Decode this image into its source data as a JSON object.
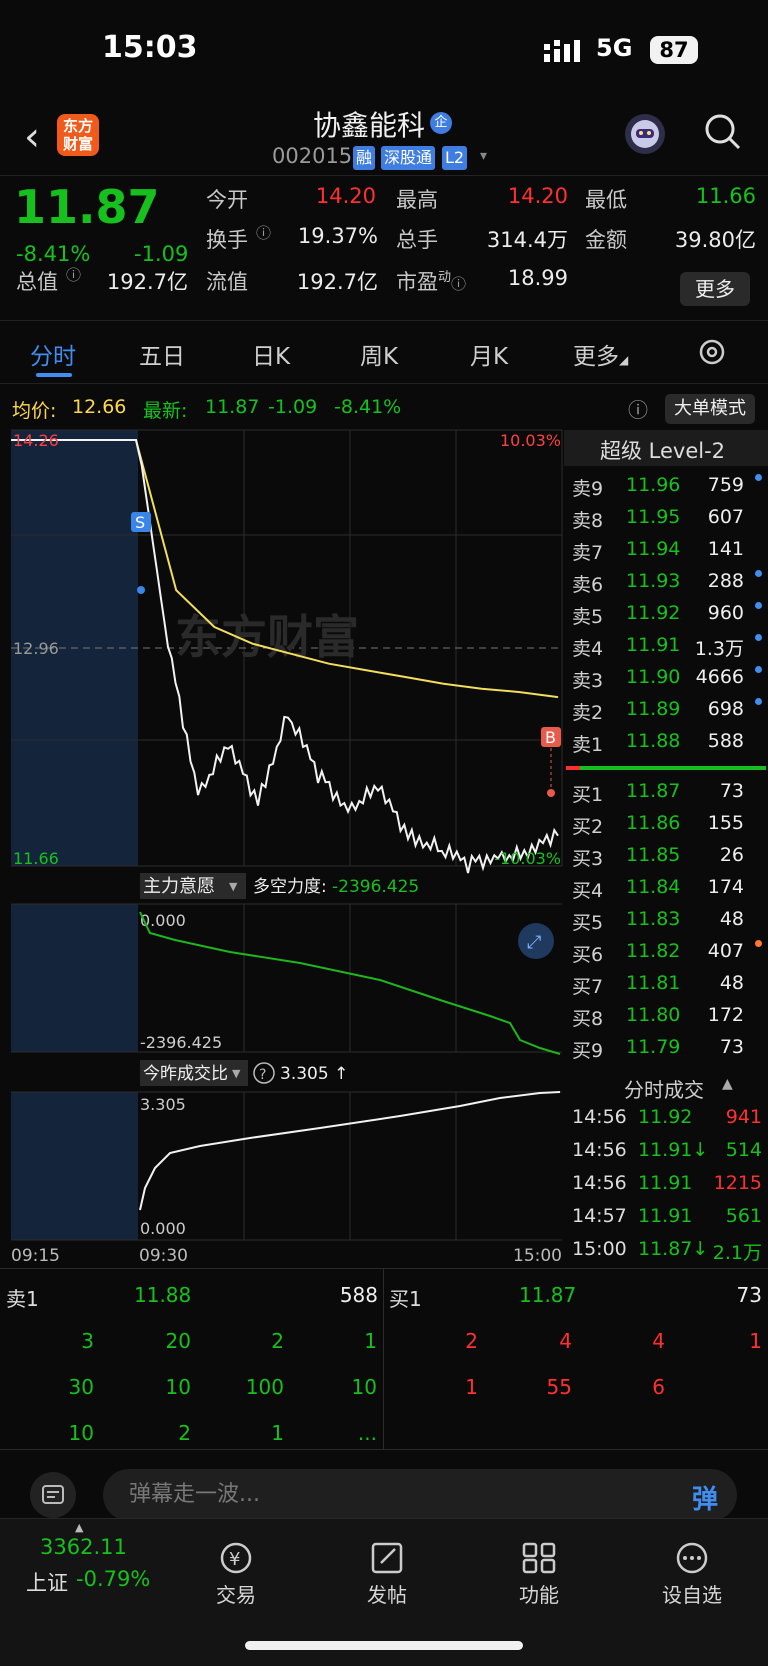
{
  "status_bar": {
    "time": "15:03",
    "network": "5G",
    "battery": "87"
  },
  "header": {
    "logo_line1": "东方",
    "logo_line2": "财富",
    "stock_name": "协鑫能科",
    "enterprise_badge": "企",
    "stock_code": "002015",
    "tags": [
      "融",
      "深股通",
      "L2"
    ]
  },
  "quote": {
    "price": "11.87",
    "change_pct": "-8.41%",
    "change": "-1.09",
    "stats": [
      {
        "label": "今开",
        "value": "14.20",
        "color": "#ff3030"
      },
      {
        "label": "最高",
        "value": "14.20",
        "color": "#ff3030"
      },
      {
        "label": "最低",
        "value": "11.66",
        "color": "#17c11d"
      },
      {
        "label": "换手",
        "value": "19.37%",
        "color": "#ececec"
      },
      {
        "label": "总手",
        "value": "314.4万",
        "color": "#ececec"
      },
      {
        "label": "金额",
        "value": "39.80亿",
        "color": "#ececec"
      },
      {
        "label": "总值",
        "value": "192.7亿",
        "color": "#ececec"
      },
      {
        "label": "流值",
        "value": "192.7亿",
        "color": "#ececec"
      },
      {
        "label": "市盈",
        "label_sup": "动",
        "value": "18.99",
        "color": "#ececec"
      }
    ],
    "more_label": "更多"
  },
  "tabs": [
    "分时",
    "五日",
    "日K",
    "周K",
    "月K",
    "更多"
  ],
  "chart_info": {
    "avg_label": "均价:",
    "avg_value": "12.66",
    "latest_label": "最新:",
    "latest_value": "11.87",
    "latest_change": "-1.09",
    "latest_pct": "-8.41%",
    "big_order_mode": "大单模式"
  },
  "chart_labels": {
    "price_high": "14.26",
    "price_mid": "12.96",
    "price_low": "11.66",
    "pct_high": "10.03%",
    "pct_low": "-10.03%",
    "marker_sell": "S",
    "marker_buy": "B",
    "main_force_label": "主力意愿",
    "bull_bear_label": "多空力度:",
    "bull_bear_value": "-2396.425",
    "mf_top": "0.000",
    "mf_bottom": "-2396.425",
    "vol_ratio_label": "今昨成交比",
    "vol_ratio_value": "3.305 ↑",
    "vr_top": "3.305",
    "vr_bottom": "0.000",
    "time_start": "09:15",
    "time_open": "09:30",
    "time_end": "15:00",
    "watermark": "东方财富"
  },
  "chart_data": {
    "type": "line",
    "x_ticks": [
      "09:15",
      "09:30",
      "15:00"
    ],
    "ylim": [
      11.66,
      14.26
    ],
    "ref_price": 12.96,
    "series": [
      {
        "values": [
          14.2,
          12.96,
          12.1,
          12.35,
          12.05,
          12.55,
          12.2,
          12.0,
          12.1,
          11.85,
          11.75,
          11.66,
          11.72,
          11.7,
          11.87
        ]
      },
      {
        "values": [
          14.2,
          13.3,
          13.08,
          12.98,
          12.92,
          12.86,
          12.82,
          12.78,
          12.74,
          12.71,
          12.69,
          12.66
        ]
      }
    ]
  },
  "order_book": {
    "title": "超级 Level-2",
    "asks": [
      {
        "label": "卖9",
        "price": "11.96",
        "vol": "759",
        "dot": "#3f8ef0"
      },
      {
        "label": "卖8",
        "price": "11.95",
        "vol": "607",
        "dot": ""
      },
      {
        "label": "卖7",
        "price": "11.94",
        "vol": "141",
        "dot": ""
      },
      {
        "label": "卖6",
        "price": "11.93",
        "vol": "288",
        "dot": "#3f8ef0"
      },
      {
        "label": "卖5",
        "price": "11.92",
        "vol": "960",
        "dot": "#3f8ef0"
      },
      {
        "label": "卖4",
        "price": "11.91",
        "vol": "1.3万",
        "dot": "#3f8ef0"
      },
      {
        "label": "卖3",
        "price": "11.90",
        "vol": "4666",
        "dot": "#3f8ef0"
      },
      {
        "label": "卖2",
        "price": "11.89",
        "vol": "698",
        "dot": "#3f8ef0"
      },
      {
        "label": "卖1",
        "price": "11.88",
        "vol": "588",
        "dot": ""
      }
    ],
    "bids": [
      {
        "label": "买1",
        "price": "11.87",
        "vol": "73",
        "dot": ""
      },
      {
        "label": "买2",
        "price": "11.86",
        "vol": "155",
        "dot": ""
      },
      {
        "label": "买3",
        "price": "11.85",
        "vol": "26",
        "dot": ""
      },
      {
        "label": "买4",
        "price": "11.84",
        "vol": "174",
        "dot": ""
      },
      {
        "label": "买5",
        "price": "11.83",
        "vol": "48",
        "dot": ""
      },
      {
        "label": "买6",
        "price": "11.82",
        "vol": "407",
        "dot": "#ff7a30"
      },
      {
        "label": "买7",
        "price": "11.81",
        "vol": "48",
        "dot": ""
      },
      {
        "label": "买8",
        "price": "11.80",
        "vol": "172",
        "dot": ""
      },
      {
        "label": "买9",
        "price": "11.79",
        "vol": "73",
        "dot": ""
      }
    ]
  },
  "trades": {
    "title": "分时成交",
    "rows": [
      {
        "time": "14:56",
        "price": "11.92",
        "vol": "941",
        "vol_color": "#ff3030"
      },
      {
        "time": "14:56",
        "price": "11.91↓",
        "vol": "514",
        "vol_color": "#17c11d"
      },
      {
        "time": "14:56",
        "price": "11.91",
        "vol": "1215",
        "vol_color": "#ff3030"
      },
      {
        "time": "14:57",
        "price": "11.91",
        "vol": "561",
        "vol_color": "#17c11d"
      },
      {
        "time": "15:00",
        "price": "11.87↓",
        "vol": "2.1万",
        "vol_color": "#17c11d"
      }
    ]
  },
  "level1": {
    "ask_label": "卖1",
    "ask_price": "11.88",
    "ask_vol": "588",
    "bid_label": "买1",
    "bid_price": "11.87",
    "bid_vol": "73",
    "ask_queue": [
      [
        "3",
        "20",
        "2",
        "1"
      ],
      [
        "30",
        "10",
        "100",
        "10"
      ],
      [
        "10",
        "2",
        "1",
        "..."
      ]
    ],
    "bid_queue": [
      [
        "2",
        "4",
        "4",
        "1"
      ],
      [
        "1",
        "55",
        "6",
        ""
      ]
    ]
  },
  "comment": {
    "placeholder": "弹幕走一波...",
    "danmu": "弹"
  },
  "nav": {
    "index_value": "3362.11",
    "index_name": "上证",
    "index_pct": "-0.79%",
    "items": [
      "交易",
      "发帖",
      "功能",
      "设自选"
    ]
  }
}
